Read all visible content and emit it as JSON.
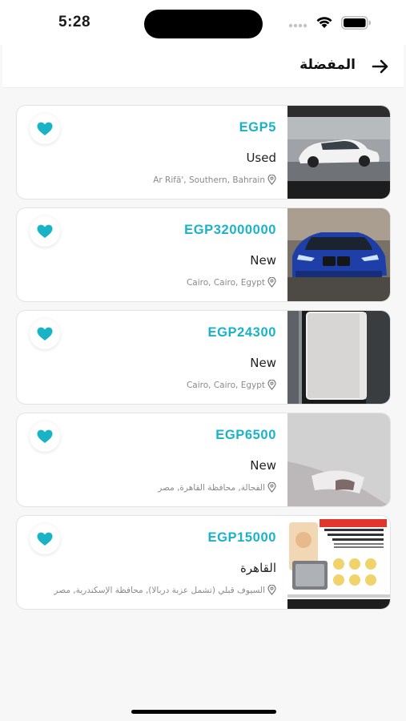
{
  "status_bar": {
    "time": "5:28"
  },
  "header": {
    "title": "المفضلة",
    "back_icon": "arrow-right-icon"
  },
  "colors": {
    "accent": "#19b3c7",
    "background": "#f7f7f8",
    "card": "#ffffff"
  },
  "favorites": [
    {
      "price": "EGP5",
      "condition": "Used",
      "location": "Ar Rifā', Southern, Bahrain",
      "image": "white-bmw-coupe"
    },
    {
      "price": "EGP32000000",
      "condition": "New",
      "location": "Cairo, Cairo, Egypt",
      "image": "blue-bmw"
    },
    {
      "price": "EGP24300",
      "condition": "New",
      "location": "Cairo, Cairo, Egypt",
      "image": "white-appliance-box"
    },
    {
      "price": "EGP6500",
      "condition": "New",
      "location": "الفجالة, محافظة القاهرة, مصر",
      "image": "handheld-light-device"
    },
    {
      "price": "EGP15000",
      "condition": "القاهرة",
      "location": "السيوف قبلي (تشمل عزبة دربالا), محافظة الإسكندرية, مصر",
      "image": "promo-flyer"
    }
  ]
}
